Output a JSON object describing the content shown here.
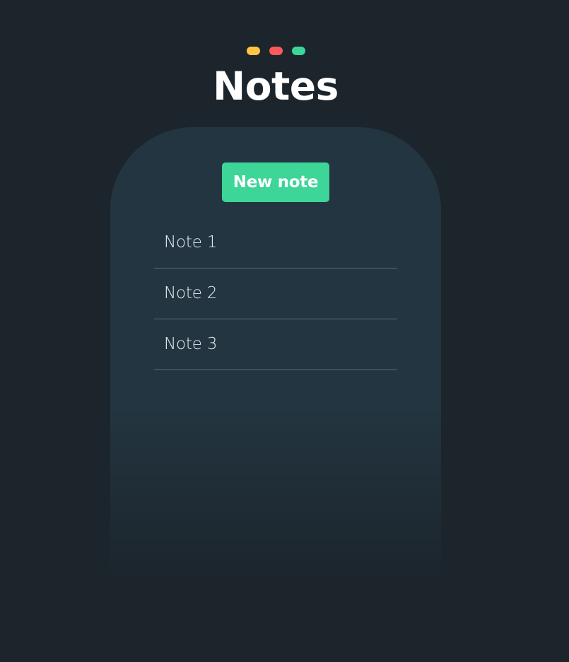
{
  "header": {
    "title": "Notes",
    "window_dots": [
      {
        "icon": "yellow-dot-icon",
        "color": "#ffc542"
      },
      {
        "icon": "red-dot-icon",
        "color": "#fc5a5a"
      },
      {
        "icon": "green-dot-icon",
        "color": "#3dd598"
      }
    ]
  },
  "panel": {
    "new_button_label": "New note",
    "notes": [
      "Note 1",
      "Note 2",
      "Note 3"
    ]
  },
  "colors": {
    "background": "#1c252c",
    "card": "#233540",
    "accent": "#3dd598",
    "divider": "#5b6d76"
  }
}
